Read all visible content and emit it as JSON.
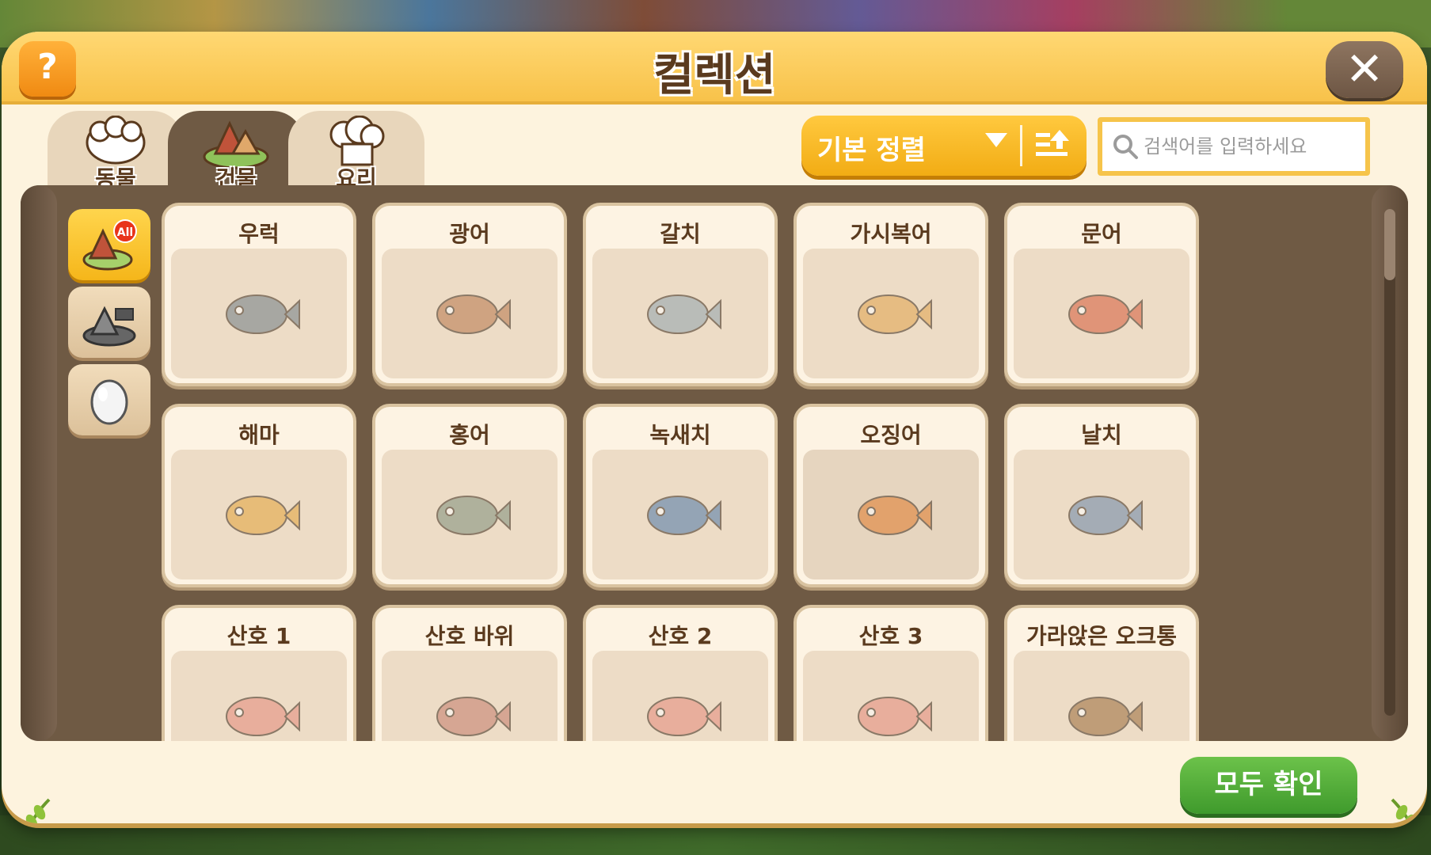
{
  "title": "컬렉션",
  "help_label": "?",
  "close_label": "✕",
  "tabs": [
    {
      "label": "동물",
      "icon": "sheep-icon",
      "active": false
    },
    {
      "label": "건물",
      "icon": "building-icon",
      "active": true
    },
    {
      "label": "요리",
      "icon": "chef-hat-icon",
      "active": false
    }
  ],
  "sort": {
    "label": "기본 정렬",
    "order_icon": "sort-ascending-icon"
  },
  "search": {
    "placeholder": "검색어를 입력하세요",
    "value": ""
  },
  "categories": [
    {
      "icon": "all-buildings-icon",
      "badge": "All",
      "active": true
    },
    {
      "icon": "fence-building-icon",
      "active": false
    },
    {
      "icon": "egg-icon",
      "active": false
    }
  ],
  "items": [
    {
      "name": "우럭",
      "icon": "rockfish-icon",
      "color": "#6f7d86"
    },
    {
      "name": "광어",
      "icon": "flounder-icon",
      "color": "#b7764a"
    },
    {
      "name": "갈치",
      "icon": "cutlassfish-icon",
      "color": "#8fa3ad"
    },
    {
      "name": "가시복어",
      "icon": "pufferfish-icon",
      "color": "#e2a24b"
    },
    {
      "name": "문어",
      "icon": "octopus-icon",
      "color": "#d65a3a"
    },
    {
      "name": "해마",
      "icon": "seahorse-icon",
      "color": "#e3a23a"
    },
    {
      "name": "홍어",
      "icon": "ray-icon",
      "color": "#7d8f7a"
    },
    {
      "name": "녹새치",
      "icon": "marlin-icon",
      "color": "#4d78a8"
    },
    {
      "name": "오징어",
      "icon": "squid-icon",
      "color": "#e07a2a"
    },
    {
      "name": "날치",
      "icon": "flyingfish-icon",
      "color": "#6a86a8"
    },
    {
      "name": "산호 1",
      "icon": "coral-icon",
      "color": "#e58a7a"
    },
    {
      "name": "산호 바위",
      "icon": "coral-rock-icon",
      "color": "#c47a6a"
    },
    {
      "name": "산호 2",
      "icon": "coral-icon",
      "color": "#e58a7a"
    },
    {
      "name": "산호 3",
      "icon": "coral-icon",
      "color": "#e58a7a"
    },
    {
      "name": "가라앉은 오크통",
      "icon": "barrel-icon",
      "color": "#9a6a3a"
    }
  ],
  "confirm_all_label": "모두 확인",
  "colors": {
    "accent": "#f8c24a",
    "frame": "#6f5a44",
    "confirm": "#3f9a2c"
  }
}
